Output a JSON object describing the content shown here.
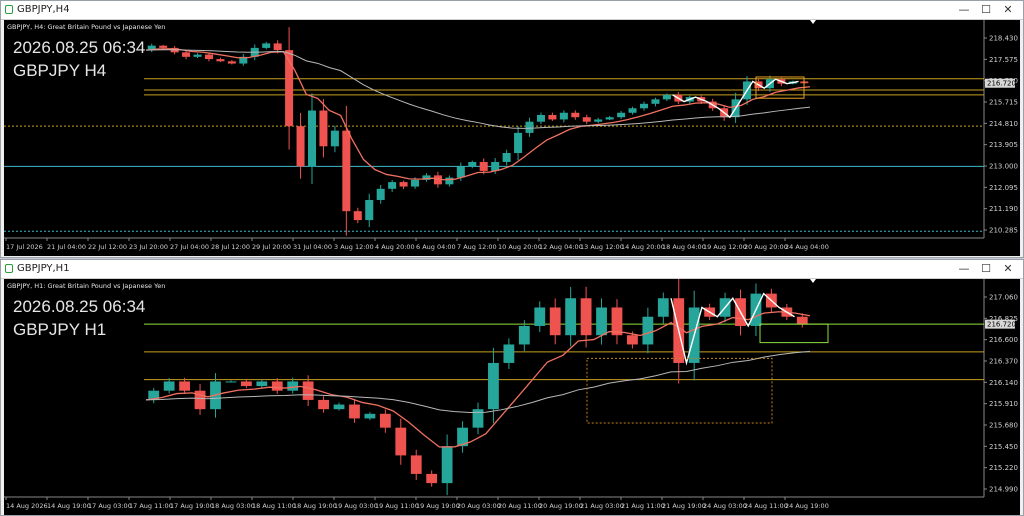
{
  "windows": [
    {
      "title": "GBPJPY,H4",
      "header_text": "GBPJPY, H4:  Great Britain Pound vs Japanese Yen",
      "overlay_datetime": "2026.08.25 06:34",
      "overlay_symbol": "GBPJPY H4",
      "buttons": {
        "minimize": "—",
        "maximize": "☐",
        "close": "✕"
      },
      "price_labels": [
        "218.430",
        "217.575",
        "216.720",
        "215.715",
        "214.810",
        "213.905",
        "213.000",
        "212.095",
        "211.190",
        "210.285"
      ],
      "current_price_label": "216.720",
      "time_labels": [
        "17 Jul 2026",
        "21 Jul 04:00",
        "22 Jul 12:00",
        "23 Jul 20:00",
        "27 Jul 04:00",
        "28 Jul 12:00",
        "29 Jul 20:00",
        "31 Jul 04:00",
        "3 Aug 12:00",
        "4 Aug 20:00",
        "6 Aug 04:00",
        "7 Aug 12:00",
        "10 Aug 20:00",
        "12 Aug 04:00",
        "13 Aug 12:00",
        "14 Aug 20:00",
        "18 Aug 04:00",
        "19 Aug 12:00",
        "20 Aug 20:00",
        "24 Aug 04:00"
      ],
      "colors": {
        "up": "#26a69a",
        "down": "#ef5350",
        "ma_fast": "#f07060",
        "ma_slow": "#b8b8b8",
        "level": "#c8a020",
        "cyan": "#40b8c8",
        "bg": "#000000"
      }
    },
    {
      "title": "GBPJPY,H1",
      "header_text": "GBPJPY, H1:  Great Britain Pound vs Japanese Yen",
      "overlay_datetime": "2026.08.25 06:34",
      "overlay_symbol": "GBPJPY H1",
      "buttons": {
        "minimize": "—",
        "maximize": "☐",
        "close": "✕"
      },
      "price_labels": [
        "217.060",
        "216.825",
        "216.600",
        "216.370",
        "216.140",
        "215.910",
        "215.680",
        "215.450",
        "215.220",
        "214.990"
      ],
      "current_price_label": "216.720",
      "time_labels": [
        "14 Aug 2026",
        "14 Aug 19:00",
        "17 Aug 03:00",
        "17 Aug 11:00",
        "17 Aug 19:00",
        "18 Aug 03:00",
        "18 Aug 11:00",
        "18 Aug 19:00",
        "19 Aug 03:00",
        "19 Aug 11:00",
        "19 Aug 19:00",
        "20 Aug 03:00",
        "20 Aug 11:00",
        "20 Aug 19:00",
        "21 Aug 03:00",
        "21 Aug 11:00",
        "21 Aug 19:00",
        "24 Aug 03:00",
        "24 Aug 11:00",
        "24 Aug 19:00"
      ],
      "colors": {
        "up": "#26a69a",
        "down": "#ef5350",
        "ma_fast": "#f07060",
        "ma_slow": "#b8b8b8",
        "level": "#c8a020",
        "green": "#90e040",
        "bg": "#000000"
      }
    }
  ],
  "chart_data": [
    {
      "type": "candlestick",
      "title": "GBPJPY, H4:  Great Britain Pound vs Japanese Yen",
      "ylim": [
        209.8,
        219.1
      ],
      "x_ticks": [
        "17 Jul 2026",
        "21 Jul 04:00",
        "22 Jul 12:00",
        "23 Jul 20:00",
        "27 Jul 04:00",
        "28 Jul 12:00",
        "29 Jul 20:00",
        "31 Jul 04:00",
        "3 Aug 12:00",
        "4 Aug 20:00",
        "6 Aug 04:00",
        "7 Aug 12:00",
        "10 Aug 20:00",
        "12 Aug 04:00",
        "13 Aug 12:00",
        "14 Aug 20:00",
        "18 Aug 04:00",
        "19 Aug 12:00",
        "20 Aug 20:00",
        "24 Aug 04:00"
      ],
      "close_path": [
        218.2,
        218.4,
        218.3,
        218.1,
        217.9,
        218.0,
        217.8,
        217.7,
        217.6,
        217.9,
        218.3,
        218.5,
        218.2,
        214.8,
        213.0,
        215.5,
        213.9,
        214.6,
        211.0,
        210.6,
        211.5,
        212.0,
        212.3,
        212.1,
        212.4,
        212.6,
        212.2,
        212.5,
        213.0,
        213.2,
        212.8,
        213.2,
        213.6,
        214.5,
        215.0,
        215.3,
        215.1,
        215.4,
        215.2,
        215.0,
        215.1,
        215.2,
        215.4,
        215.6,
        215.8,
        216.0,
        216.2,
        215.9,
        216.1,
        215.9,
        215.6,
        215.2,
        216.0,
        216.8,
        216.5,
        216.9,
        216.7,
        216.8,
        216.72
      ],
      "levels": [
        216.42,
        216.2,
        216.92,
        214.8,
        213.0,
        210.1
      ]
    },
    {
      "type": "candlestick",
      "title": "GBPJPY, H1:  Great Britain Pound vs Japanese Yen",
      "ylim": [
        214.85,
        217.1
      ],
      "x_ticks": [
        "14 Aug 2026",
        "14 Aug 19:00",
        "17 Aug 03:00",
        "17 Aug 11:00",
        "17 Aug 19:00",
        "18 Aug 03:00",
        "18 Aug 11:00",
        "18 Aug 19:00",
        "19 Aug 03:00",
        "19 Aug 11:00",
        "19 Aug 19:00",
        "20 Aug 03:00",
        "20 Aug 11:00",
        "20 Aug 19:00",
        "21 Aug 03:00",
        "21 Aug 11:00",
        "21 Aug 19:00",
        "24 Aug 03:00",
        "24 Aug 11:00",
        "24 Aug 19:00"
      ],
      "close_path": [
        215.9,
        216.0,
        216.1,
        216.0,
        215.8,
        216.1,
        216.1,
        216.05,
        216.1,
        216.0,
        216.1,
        215.9,
        215.8,
        215.85,
        215.7,
        215.75,
        215.6,
        215.3,
        215.1,
        215.0,
        215.4,
        215.6,
        215.8,
        216.3,
        216.5,
        216.7,
        216.9,
        216.6,
        217.0,
        216.6,
        216.9,
        216.6,
        216.5,
        216.8,
        217.0,
        216.3,
        216.9,
        216.8,
        217.0,
        216.7,
        217.05,
        216.9,
        216.8,
        216.72
      ],
      "levels": [
        216.72,
        216.42,
        216.12
      ]
    }
  ]
}
